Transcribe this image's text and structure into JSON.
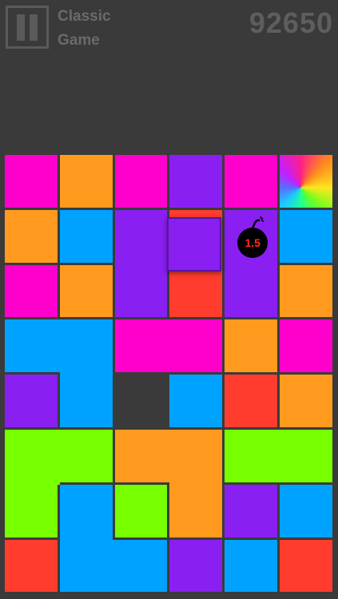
{
  "header": {
    "mode_line1": "Classic",
    "mode_line2": "Game",
    "score": "92650"
  },
  "colors": {
    "M": "#ff00cc",
    "O": "#ff9a1f",
    "P": "#8a1ff2",
    "B": "#00a2ff",
    "R": "#ff3c2e",
    "G": "#77ff00",
    "E": "#3a3a3a"
  },
  "board": {
    "cols": 6,
    "rows": 8,
    "grid": [
      [
        "M",
        "O",
        "M",
        "P",
        "M",
        "X"
      ],
      [
        "O",
        "B",
        "P",
        "R",
        "P",
        "B"
      ],
      [
        "M",
        "O",
        "P",
        "R",
        "P",
        "O"
      ],
      [
        "B",
        "B",
        "M",
        "M",
        "O",
        "M"
      ],
      [
        "P",
        "B",
        "E",
        "B",
        "R",
        "O"
      ],
      [
        "G",
        "G",
        "O",
        "O",
        "G",
        "G"
      ],
      [
        "G",
        "B",
        "G",
        "O",
        "P",
        "B"
      ],
      [
        "R",
        "B",
        "B",
        "P",
        "B",
        "R"
      ]
    ],
    "floating_tile": {
      "row": 1,
      "col": 3,
      "color": "P"
    },
    "bomb": {
      "row": 1,
      "col": 4,
      "label": "1.5"
    }
  }
}
